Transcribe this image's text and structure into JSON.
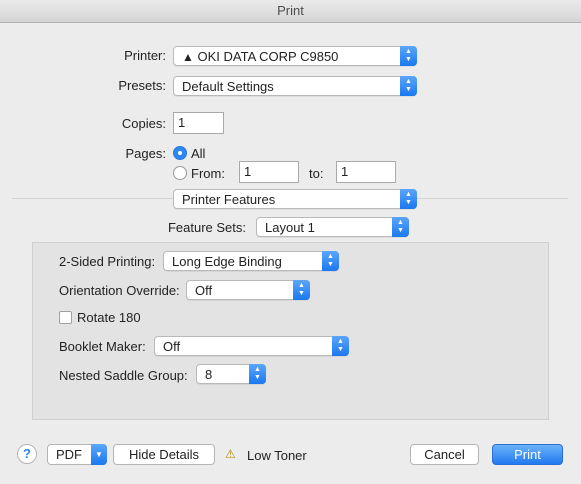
{
  "window": {
    "title": "Print"
  },
  "printer": {
    "label": "Printer:",
    "value": "OKI DATA CORP C9850",
    "warning_icon": "warning-triangle-icon"
  },
  "presets": {
    "label": "Presets:",
    "value": "Default Settings"
  },
  "copies": {
    "label": "Copies:",
    "value": "1"
  },
  "pages": {
    "label": "Pages:",
    "all_label": "All",
    "from_label": "From:",
    "from_value": "1",
    "to_label": "to:",
    "to_value": "1",
    "selected": "All"
  },
  "section": {
    "value": "Printer Features"
  },
  "feature_sets": {
    "label": "Feature Sets:",
    "value": "Layout 1"
  },
  "features": {
    "two_sided": {
      "label": "2-Sided Printing:",
      "value": "Long Edge Binding"
    },
    "orientation": {
      "label": "Orientation Override:",
      "value": "Off"
    },
    "rotate": {
      "label": "Rotate 180",
      "checked": false
    },
    "booklet": {
      "label": "Booklet Maker:",
      "value": "Off"
    },
    "saddle": {
      "label": "Nested Saddle Group:",
      "value": "8"
    }
  },
  "bottom": {
    "help_label": "?",
    "pdf_label": "PDF",
    "hide_details_label": "Hide Details",
    "status_text": "Low Toner",
    "cancel_label": "Cancel",
    "print_label": "Print"
  },
  "colors": {
    "accent": "#2d87f5",
    "warning": "#e0b000"
  }
}
